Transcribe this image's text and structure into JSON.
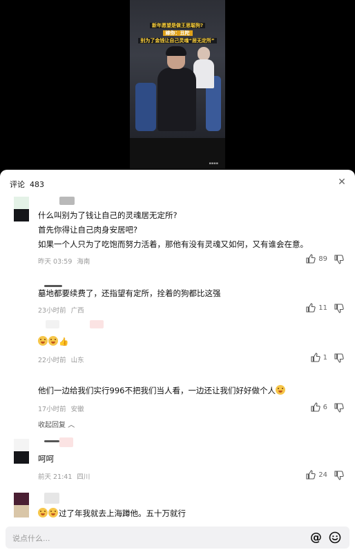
{
  "video": {
    "caption_line1": "新年愿望是做王思聪狗?",
    "caption_line2": "嫁你：丑陀",
    "caption_line3": "别为了金钱让自己灵魂“居无定所”"
  },
  "comments_header": {
    "label": "评论",
    "count": "483"
  },
  "comments": [
    {
      "lines": [
        "什么叫别为了钱让自己的灵魂居无定所?",
        "首先你得让自己肉身安居吧?",
        "如果一个人只为了吃饱而努力活着，那他有没有灵魂又如何，又有谁会在意。"
      ],
      "time": "昨天 03:59",
      "location": "海南",
      "likes": "89"
    },
    {
      "lines": [
        "墓地都要续费了，还指望有定所，拴着的狗都比这强"
      ],
      "time": "23小时前",
      "location": "广西",
      "likes": "11"
    },
    {
      "text": "",
      "time": "22小时前",
      "location": "山东",
      "likes": "1"
    },
    {
      "text": "他们一边给我们实行996不把我们当人看，一边还让我们好好做个人",
      "time": "17小时前",
      "location": "安徽",
      "likes": "6",
      "collapse": "收起回复"
    },
    {
      "text": "呵呵",
      "time": "前天 21:41",
      "location": "四川",
      "likes": "24"
    },
    {
      "text": "过了年我就去上海蹲他。五十万就行"
    }
  ],
  "input": {
    "placeholder": "说点什么..."
  },
  "icons": {
    "close": "close-icon",
    "like": "thumbs-up-icon",
    "dislike": "thumbs-down-icon",
    "mention": "at-icon",
    "emoji": "smiley-icon"
  }
}
